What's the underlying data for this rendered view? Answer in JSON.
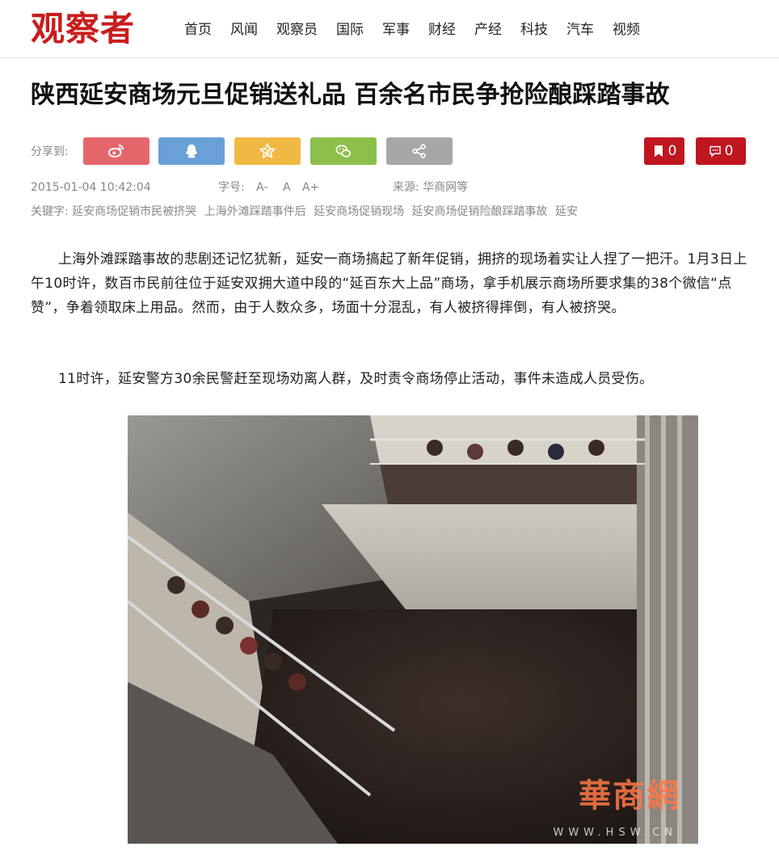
{
  "header": {
    "logo": "观察者",
    "nav": [
      "首页",
      "风闻",
      "观察员",
      "国际",
      "军事",
      "财经",
      "产经",
      "科技",
      "汽车",
      "视频"
    ]
  },
  "article": {
    "title": "陕西延安商场元旦促销送礼品 百余名市民争抢险酿踩踏事故",
    "share_label": "分享到:",
    "share_buttons": [
      {
        "icon": "weibo-icon",
        "color": "#e5666a"
      },
      {
        "icon": "qq-icon",
        "color": "#6aa0d8"
      },
      {
        "icon": "qzone-star-icon",
        "color": "#f0b944"
      },
      {
        "icon": "wechat-icon",
        "color": "#8cc04b"
      },
      {
        "icon": "share-icon",
        "color": "#a7a7a7"
      }
    ],
    "bookmark_count": "0",
    "comment_count": "0",
    "date": "2015-01-04 10:42:04",
    "font_size_label": "字号:",
    "font_sizes": [
      "A-",
      "A",
      "A+"
    ],
    "source_label": "来源:",
    "source": "华商网等",
    "keywords_label": "关键字:",
    "keywords": [
      "延安商场促销市民被挤哭",
      "上海外滩踩踏事件后",
      "延安商场促销现场",
      "延安商场促销险酿踩踏事故",
      "延安"
    ],
    "paragraphs": [
      "上海外滩踩踏事故的悲剧还记忆犹新，延安一商场搞起了新年促销，拥挤的现场着实让人捏了一把汗。1月3日上午10时许，数百市民前往位于延安双拥大道中段的“延百东大上品”商场，拿手机展示商场所要求集的38个微信“点赞”，争着领取床上用品。然而，由于人数众多，场面十分混乱，有人被挤得摔倒，有人被挤哭。",
      "11时许，延安警方30余民警赶至现场劝离人群，及时责令商场停止活动，事件未造成人员受伤。"
    ],
    "photo_watermark": "華商網",
    "photo_watermark_url": "WWW.HSW.CN"
  }
}
